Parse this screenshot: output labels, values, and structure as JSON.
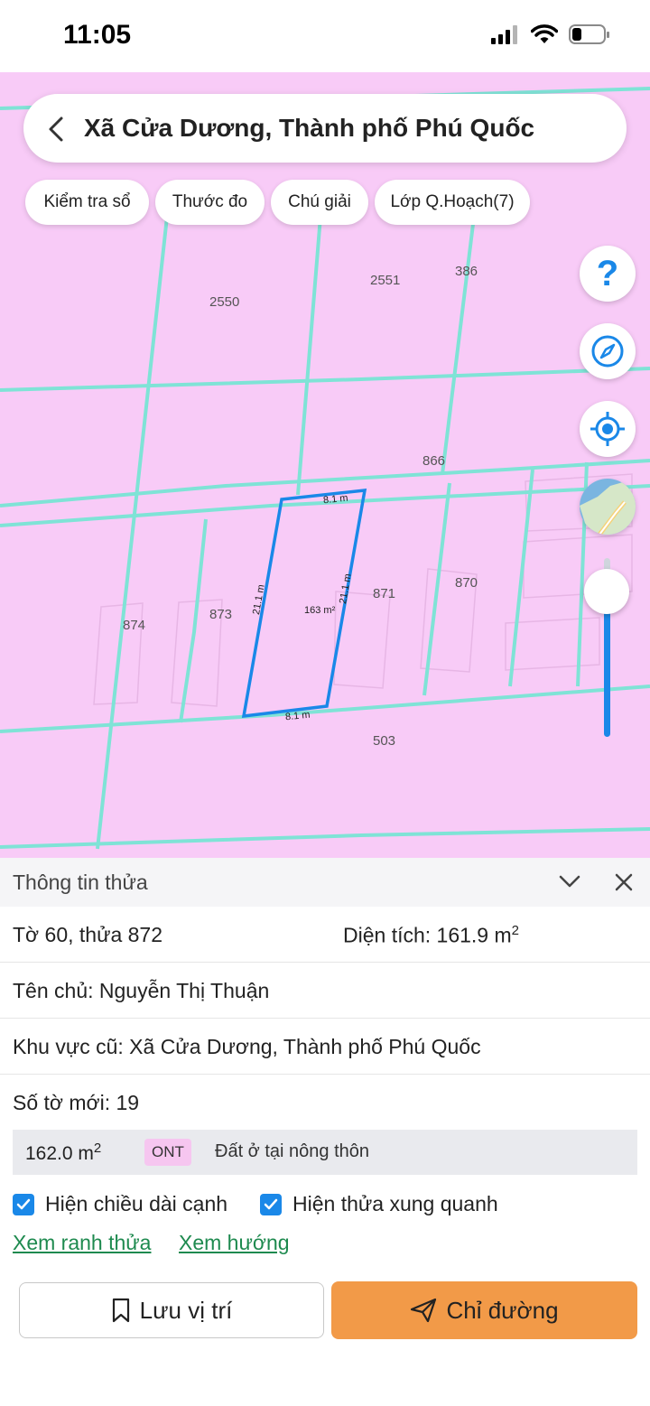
{
  "status": {
    "time": "11:05"
  },
  "header": {
    "title": "Xã Cửa Dương, Thành phố Phú Quốc"
  },
  "chips": [
    {
      "label": "Kiểm tra sổ"
    },
    {
      "label": "Thước đo"
    },
    {
      "label": "Chú giải"
    },
    {
      "label": "Lớp Q.Hoạch(7)"
    }
  ],
  "map": {
    "parcel_labels": [
      "2550",
      "2551",
      "386",
      "866",
      "874",
      "873",
      "871",
      "870",
      "503"
    ],
    "selected": {
      "area": "163 m²",
      "edge_top": "8.1 m",
      "edge_bottom": "8.1 m",
      "edge_left": "21.1 m",
      "edge_right": "21.1 m"
    },
    "help_label": "?",
    "colors": {
      "land": "#f8cbf7",
      "boundary": "#7fe3d6",
      "selected": "#1a88e8"
    }
  },
  "sheet": {
    "title": "Thông tin thửa",
    "parcel_id": "Tờ 60, thửa 872",
    "area_label": "Diện tích: 161.9 m",
    "area_sup": "2",
    "owner": "Tên chủ: Nguyễn Thị Thuận",
    "old_area": "Khu vực cũ: Xã Cửa Dương, Thành phố Phú Quốc",
    "new_sheet": "Số tờ mới: 19",
    "zone": {
      "area": "162.0 m",
      "area_sup": "2",
      "code": "ONT",
      "description": "Đất ở tại nông thôn"
    },
    "checkboxes": [
      {
        "label": "Hiện chiều dài cạnh",
        "checked": true
      },
      {
        "label": "Hiện thửa xung quanh",
        "checked": true
      }
    ],
    "links": [
      "Xem ranh thửa",
      "Xem hướng"
    ],
    "buttons": {
      "save": "Lưu vị trí",
      "directions": "Chỉ đường"
    },
    "accent": "#f29a48"
  }
}
